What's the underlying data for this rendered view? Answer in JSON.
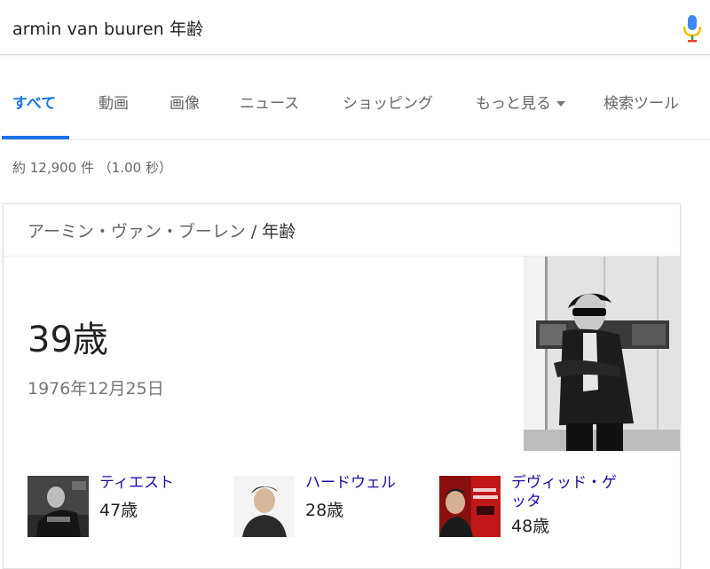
{
  "search": {
    "query": "armin van buuren 年齢"
  },
  "tabs": [
    {
      "label": "すべて",
      "active": true
    },
    {
      "label": "動画"
    },
    {
      "label": "画像"
    },
    {
      "label": "ニュース"
    },
    {
      "label": "ショッピング"
    },
    {
      "label": "もっと見る"
    },
    {
      "label": "検索ツール"
    }
  ],
  "result_stats": "約 12,900 件 （1.00 秒）",
  "card": {
    "entity": "アーミン・ヴァン・ブーレン",
    "separator": "/",
    "attribute": "年齢",
    "age": "39歳",
    "birthdate": "1976年12月25日",
    "related": [
      {
        "name": "ティエスト",
        "age": "47歳"
      },
      {
        "name": "ハードウェル",
        "age": "28歳"
      },
      {
        "name": "デヴィッド・ゲッタ",
        "age": "48歳"
      }
    ]
  },
  "colors": {
    "accent": "#1a73e8",
    "link": "#1a0dab"
  }
}
